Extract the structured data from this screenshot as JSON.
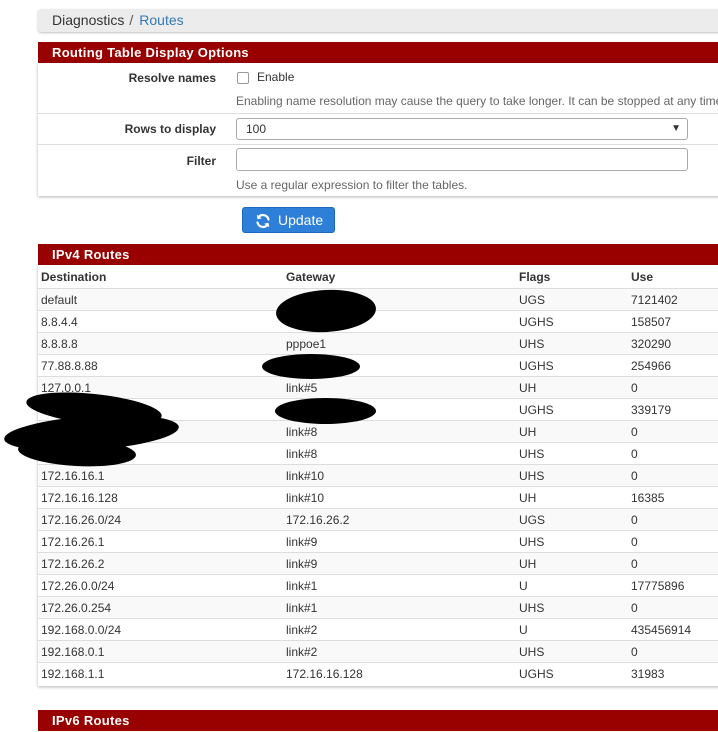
{
  "breadcrumb": {
    "home": "Diagnostics",
    "separator": "/",
    "current": "Routes"
  },
  "options_panel": {
    "title": "Routing Table Display Options",
    "resolve_names": {
      "label": "Resolve names",
      "checkbox_label": "Enable",
      "help": "Enabling name resolution may cause the query to take longer. It can be stopped at any time"
    },
    "rows_to_display": {
      "label": "Rows to display",
      "value": "100"
    },
    "filter": {
      "label": "Filter",
      "value": "",
      "help": "Use a regular expression to filter the tables."
    },
    "update_button": "Update"
  },
  "ipv4": {
    "title": "IPv4 Routes",
    "columns": {
      "destination": "Destination",
      "gateway": "Gateway",
      "flags": "Flags",
      "use": "Use"
    },
    "rows": [
      {
        "destination": "default",
        "gateway": "",
        "flags": "UGS",
        "use": "7121402"
      },
      {
        "destination": "8.8.4.4",
        "gateway": "",
        "flags": "UGHS",
        "use": "158507"
      },
      {
        "destination": "8.8.8.8",
        "gateway": "pppoe1",
        "flags": "UHS",
        "use": "320290"
      },
      {
        "destination": "77.88.8.88",
        "gateway": "",
        "flags": "UGHS",
        "use": "254966"
      },
      {
        "destination": "127.0.0.1",
        "gateway": "link#5",
        "flags": "UH",
        "use": "0"
      },
      {
        "destination": "",
        "gateway": "",
        "flags": "UGHS",
        "use": "339179"
      },
      {
        "destination": "",
        "gateway": "link#8",
        "flags": "UH",
        "use": "0"
      },
      {
        "destination": "",
        "gateway": "link#8",
        "flags": "UHS",
        "use": "0"
      },
      {
        "destination": "172.16.16.1",
        "gateway": "link#10",
        "flags": "UHS",
        "use": "0"
      },
      {
        "destination": "172.16.16.128",
        "gateway": "link#10",
        "flags": "UH",
        "use": "16385"
      },
      {
        "destination": "172.16.26.0/24",
        "gateway": "172.16.26.2",
        "flags": "UGS",
        "use": "0"
      },
      {
        "destination": "172.16.26.1",
        "gateway": "link#9",
        "flags": "UHS",
        "use": "0"
      },
      {
        "destination": "172.16.26.2",
        "gateway": "link#9",
        "flags": "UH",
        "use": "0"
      },
      {
        "destination": "172.26.0.0/24",
        "gateway": "link#1",
        "flags": "U",
        "use": "17775896"
      },
      {
        "destination": "172.26.0.254",
        "gateway": "link#1",
        "flags": "UHS",
        "use": "0"
      },
      {
        "destination": "192.168.0.0/24",
        "gateway": "link#2",
        "flags": "U",
        "use": "435456914"
      },
      {
        "destination": "192.168.0.1",
        "gateway": "link#2",
        "flags": "UHS",
        "use": "0"
      },
      {
        "destination": "192.168.1.1",
        "gateway": "172.16.16.128",
        "flags": "UGHS",
        "use": "31983"
      }
    ]
  },
  "ipv6": {
    "title": "IPv6 Routes"
  },
  "icons": {
    "update": "refresh-icon",
    "select": "chevron-down-icon"
  },
  "colors": {
    "panel_heading": "#990000",
    "button": "#2e7fd8",
    "link": "#337ab7"
  }
}
